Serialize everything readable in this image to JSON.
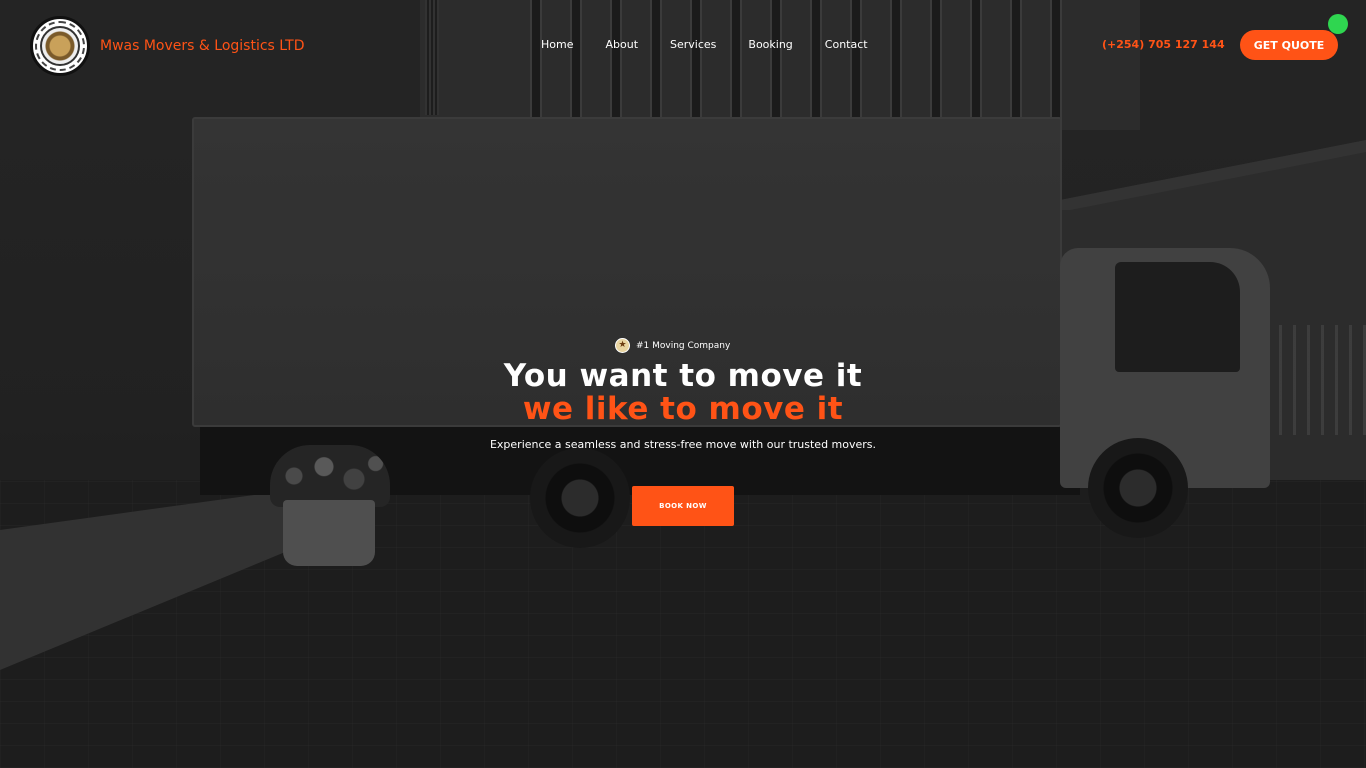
{
  "brand": {
    "name": "Mwas Movers & Logistics LTD",
    "logo_icon": "company-logo-truck-badge"
  },
  "nav": {
    "items": [
      {
        "label": "Home"
      },
      {
        "label": "About"
      },
      {
        "label": "Services"
      },
      {
        "label": "Booking"
      },
      {
        "label": "Contact"
      }
    ]
  },
  "header": {
    "phone": "(+254) 705 127 144",
    "quote_label": "GET QUOTE",
    "status_dot_color": "#2fd650"
  },
  "hero": {
    "tag_icon": "star-badge-icon",
    "tag_text": "#1 Moving Company",
    "title_line1": "You want to move it",
    "title_line2": "we like to move it",
    "subtitle": "Experience a seamless and stress-free move with our trusted movers.",
    "cta_label": "BOOK NOW"
  },
  "colors": {
    "accent": "#ff5316",
    "text": "#ffffff",
    "background": "#1b1b1b"
  }
}
